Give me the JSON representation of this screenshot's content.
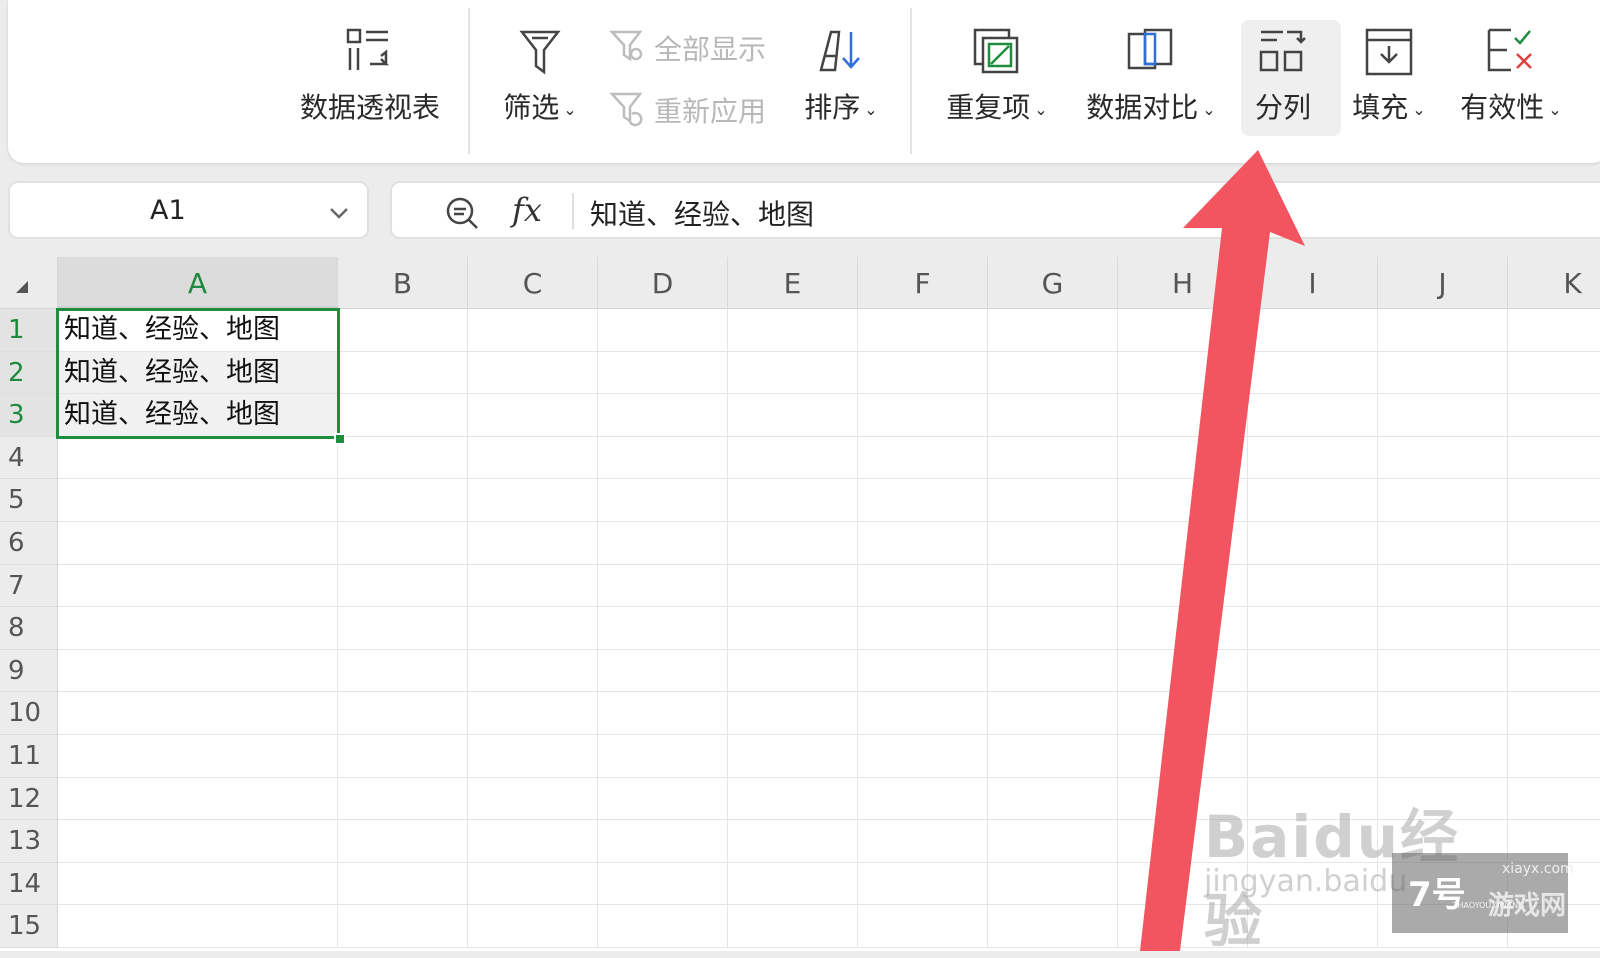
{
  "ribbon": {
    "pivot_label": "数据透视表",
    "filter_label": "筛选",
    "show_all_label": "全部显示",
    "reapply_label": "重新应用",
    "sort_label": "排序",
    "duplicates_label": "重复项",
    "compare_label": "数据对比",
    "split_label": "分列",
    "fill_label": "填充",
    "validity_label": "有效性"
  },
  "formula_bar": {
    "cell_ref": "A1",
    "fx_label": "fx",
    "content": "知道、经验、地图"
  },
  "sheet": {
    "columns": [
      "A",
      "B",
      "C",
      "D",
      "E",
      "F",
      "G",
      "H",
      "I",
      "J",
      "K"
    ],
    "rows": [
      "1",
      "2",
      "3",
      "4",
      "5",
      "6",
      "7",
      "8",
      "9",
      "10",
      "11",
      "12",
      "13",
      "14",
      "15"
    ],
    "cells": {
      "A1": "知道、经验、地图",
      "A2": "知道、经验、地图",
      "A3": "知道、经验、地图"
    },
    "selection": "A1:A3",
    "accent_color": "#1e8e3e"
  },
  "overlays": {
    "arrow_color": "#f2555f",
    "watermark_brand": "Baidu经验",
    "watermark_url": "jingyan.baidu",
    "badge_num": "7号",
    "badge_text": "游戏网",
    "badge_url": "xiayx.com",
    "badge_sub": "ZHAOYOUXIWANG"
  }
}
